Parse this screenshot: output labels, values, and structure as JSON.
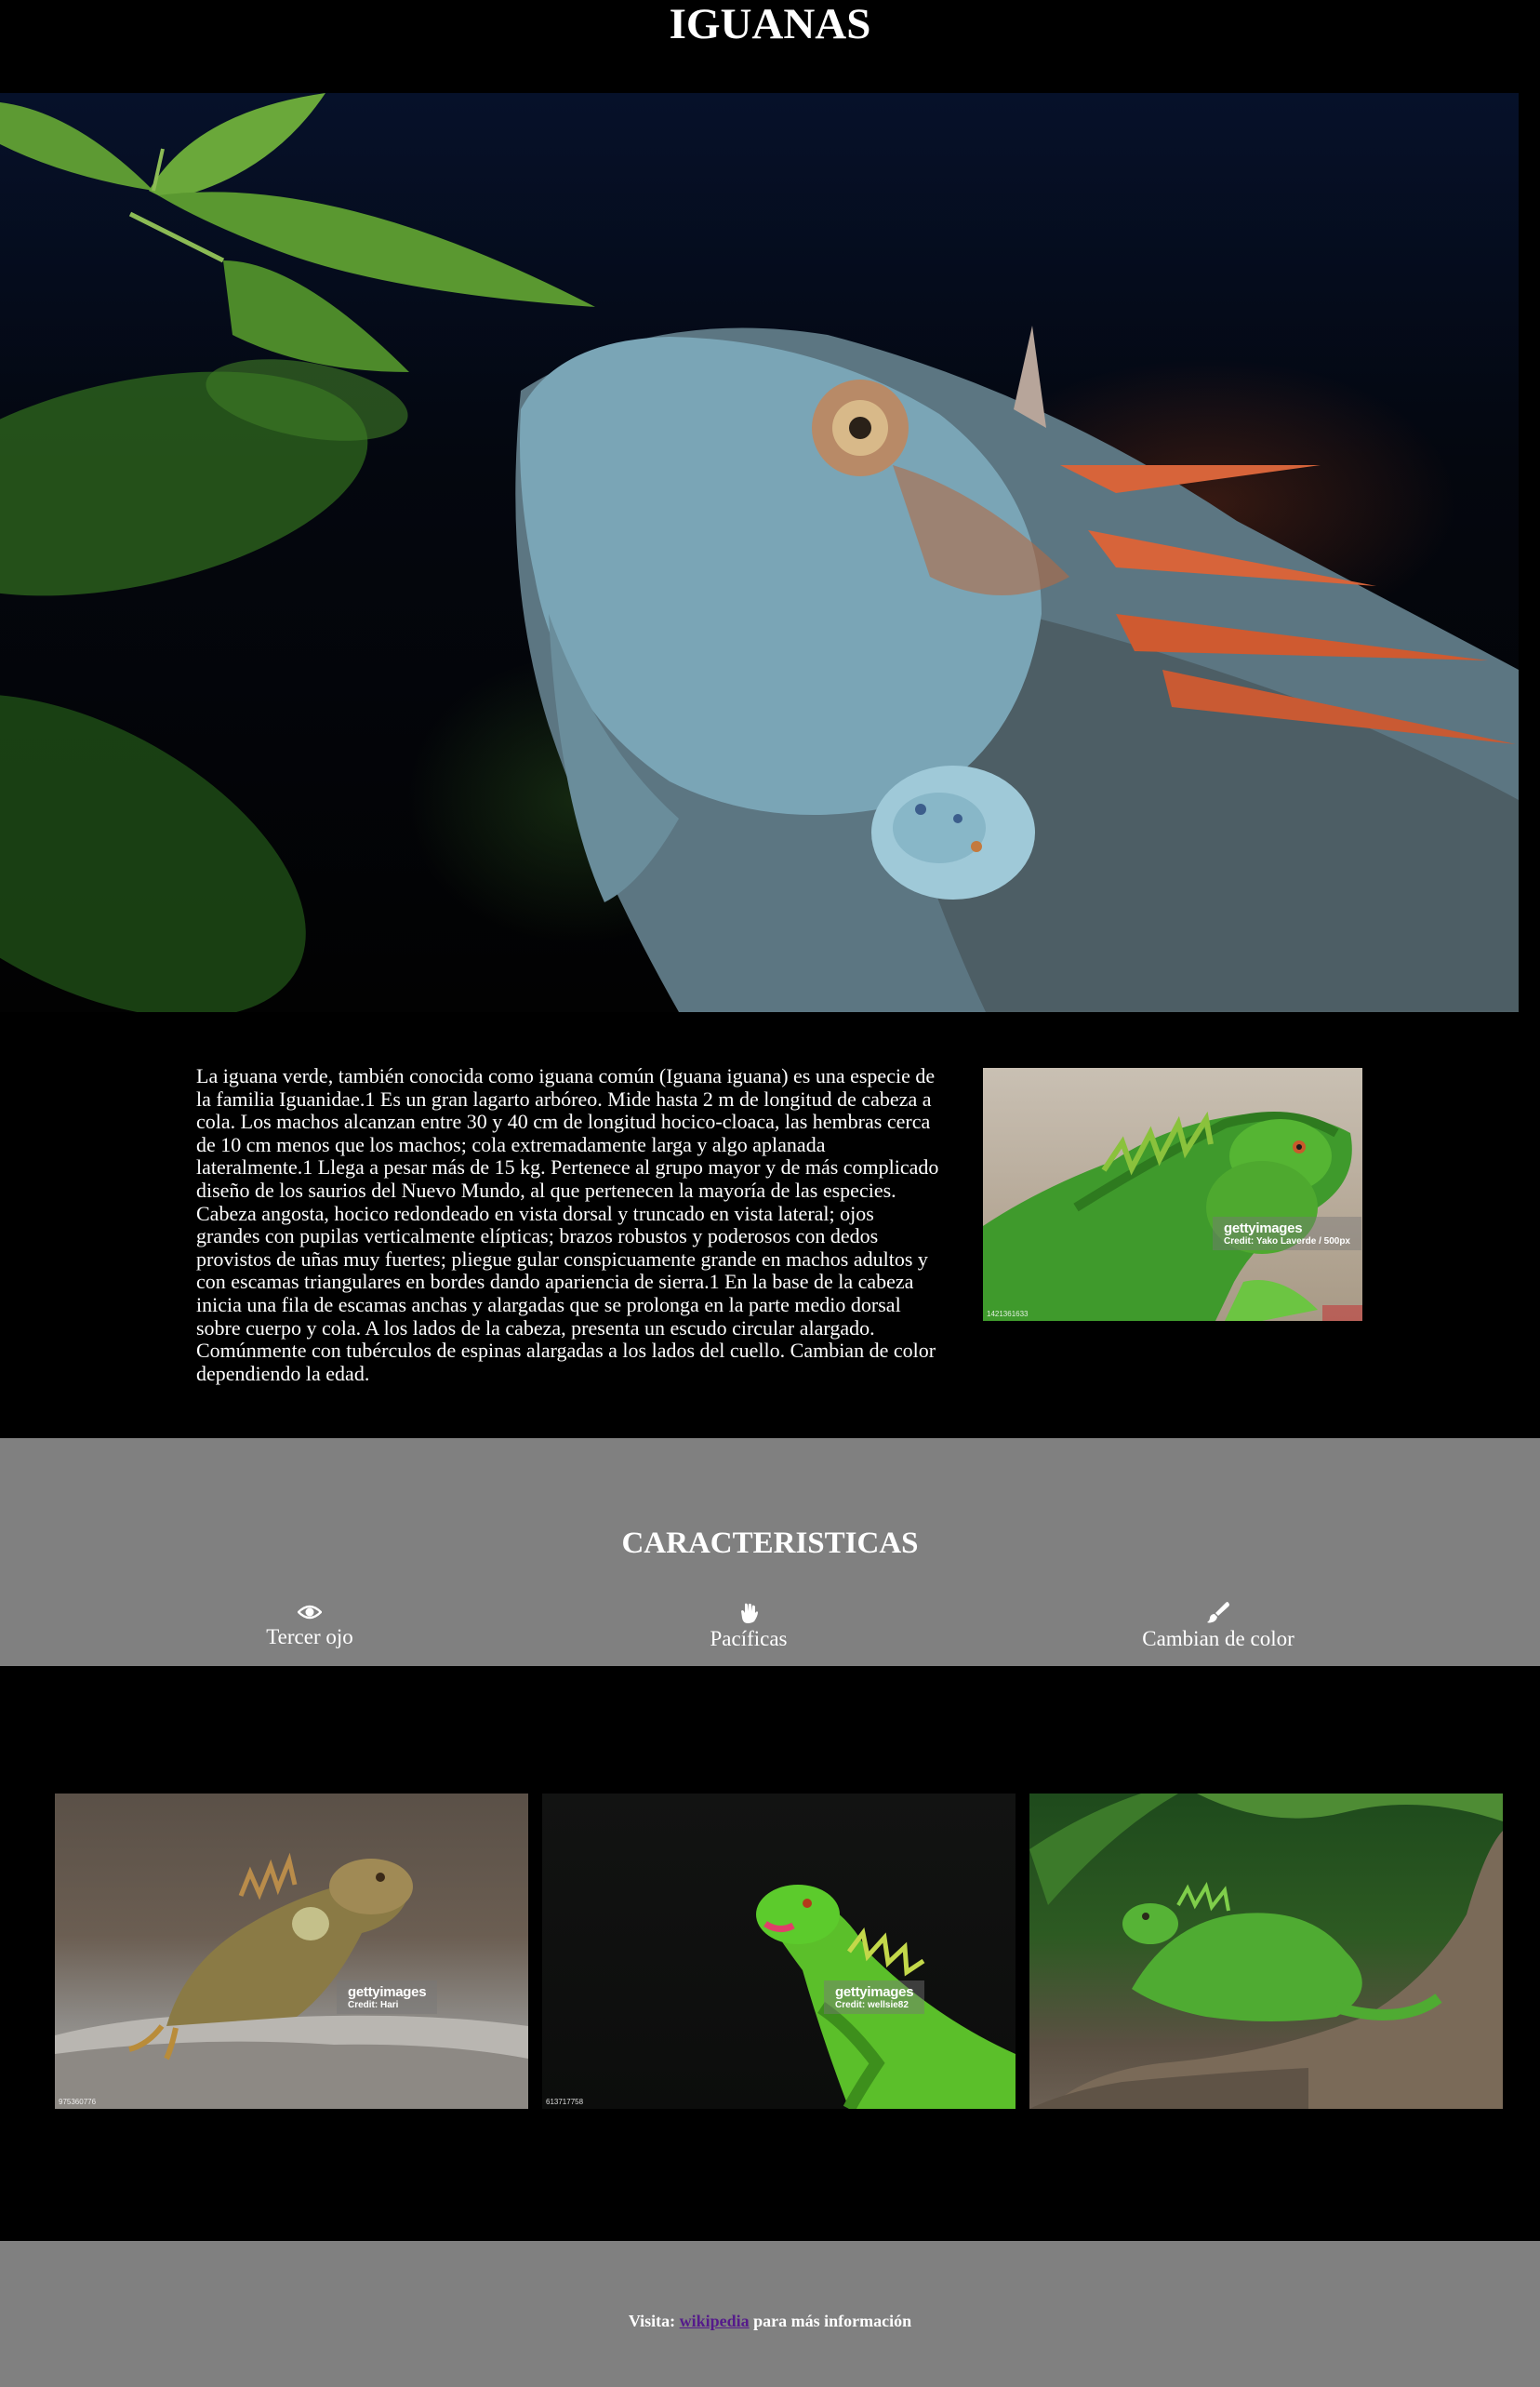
{
  "header": {
    "title": "IGUANAS"
  },
  "intro": {
    "paragraph": "La iguana verde, también conocida como iguana común (Iguana iguana) es una especie de la familia Iguanidae.1 Es un gran lagarto arbóreo. Mide hasta 2 m de longitud de cabeza a cola. Los machos alcanzan entre 30 y 40 cm de longitud hocico-cloaca, las hembras cerca de 10 cm menos que los machos; cola extremadamente larga y algo aplanada lateralmente.1 Llega a pesar más de 15 kg. Pertenece al grupo mayor y de más complicado diseño de los saurios del Nuevo Mundo, al que pertenecen la mayoría de las especies. Cabeza angosta, hocico redondeado en vista dorsal y truncado en vista lateral; ojos grandes con pupilas verticalmente elípticas; brazos robustos y poderosos con dedos provistos de uñas muy fuertes; pliegue gular conspicuamente grande en machos adultos y con escamas triangulares en bordes dando apariencia de sierra.1 En la base de la cabeza inicia una fila de escamas anchas y alargadas que se prolonga en la parte medio dorsal sobre cuerpo y cola. A los lados de la cabeza, presenta un escudo circular alargado. Comúnmente con tubérculos de espinas alargadas a los lados del cuello. Cambian de color dependiendo la edad.",
    "photo": {
      "watermark": "gettyimages",
      "credit": "Credit: Yako Laverde / 500px",
      "id": "1421361633"
    }
  },
  "features": {
    "title": "CARACTERISTICAS",
    "items": [
      {
        "icon": "eye-icon",
        "label": "Tercer ojo"
      },
      {
        "icon": "hand-icon",
        "label": "Pacíficas"
      },
      {
        "icon": "paintbrush-icon",
        "label": "Cambian de color"
      }
    ]
  },
  "gallery": [
    {
      "watermark": "gettyimages",
      "credit": "Credit: Hari",
      "id": "975360776"
    },
    {
      "watermark": "gettyimages",
      "credit": "Credit: wellsie82",
      "id": "613717758"
    },
    {
      "watermark": "",
      "credit": "",
      "id": ""
    }
  ],
  "footer": {
    "prefix": "Visita:",
    "link_text": "wikipedia",
    "suffix": "para más información"
  },
  "colors": {
    "page_background": "#000000",
    "band_background": "#808080",
    "text": "#ffffff",
    "link": "#551a8b"
  }
}
